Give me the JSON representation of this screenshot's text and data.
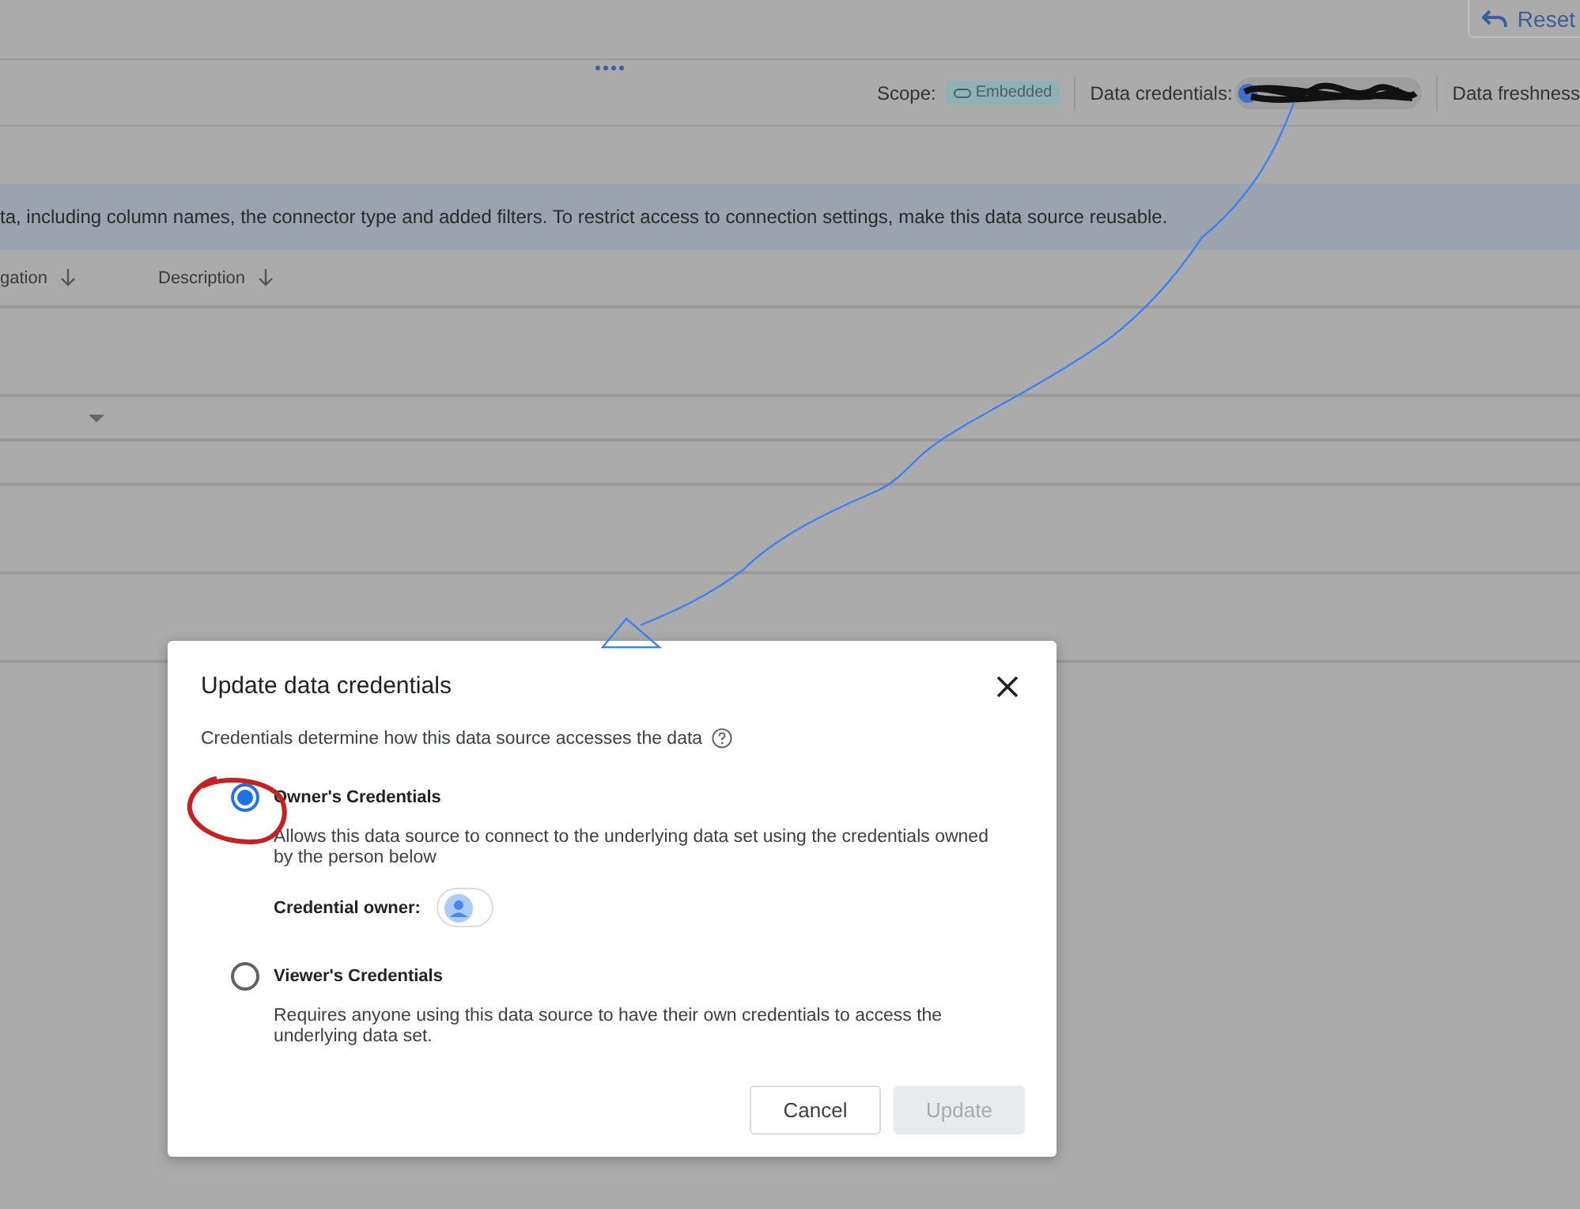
{
  "top_bar": {
    "reset_button": "Reset"
  },
  "toolbar": {
    "scope_label": "Scope:",
    "scope_badge": "Embedded",
    "credentials_label": "Data credentials:",
    "freshness_label": "Data freshness"
  },
  "banner": {
    "text": "ta, including column names, the connector type and added filters. To restrict access to connection settings, make this data source reusable."
  },
  "table": {
    "columns": [
      "gation",
      "Description"
    ]
  },
  "dialog": {
    "title": "Update data credentials",
    "subtitle": "Credentials determine how this data source accesses the data",
    "options": [
      {
        "label": "Owner's Credentials",
        "description": "Allows this data source to connect to the underlying data set using the credentials owned by the person below",
        "selected": true,
        "owner_label": "Credential owner:"
      },
      {
        "label": "Viewer's Credentials",
        "description": "Requires anyone using this data source to have their own credentials to access the underlying data set.",
        "selected": false
      }
    ],
    "buttons": [
      {
        "label": "Cancel",
        "disabled": false
      },
      {
        "label": "Update",
        "disabled": true
      }
    ]
  }
}
